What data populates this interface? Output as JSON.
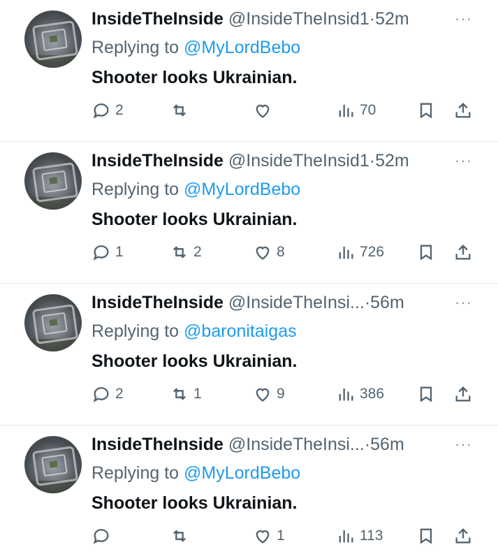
{
  "tweets": [
    {
      "name": "InsideTheInside",
      "handle": "@InsideTheInsid1",
      "dot": "·",
      "time": "52m",
      "more": "···",
      "reply_prefix": "Replying to",
      "reply_to": "@MyLordBebo",
      "text": "Shooter looks Ukrainian.",
      "replies": "2",
      "retweets": "",
      "likes": "",
      "views": "70"
    },
    {
      "name": "InsideTheInside",
      "handle": "@InsideTheInsid1",
      "dot": "·",
      "time": "52m",
      "more": "···",
      "reply_prefix": "Replying to",
      "reply_to": "@MyLordBebo",
      "text": "Shooter looks Ukrainian.",
      "replies": "1",
      "retweets": "2",
      "likes": "8",
      "views": "726"
    },
    {
      "name": "InsideTheInside",
      "handle": "@InsideTheInsi...",
      "dot": "·",
      "time": "56m",
      "more": "···",
      "reply_prefix": "Replying to",
      "reply_to": "@baronitaigas",
      "text": "Shooter looks Ukrainian.",
      "replies": "2",
      "retweets": "1",
      "likes": "9",
      "views": "386"
    },
    {
      "name": "InsideTheInside",
      "handle": "@InsideTheInsi...",
      "dot": "·",
      "time": "56m",
      "more": "···",
      "reply_prefix": "Replying to",
      "reply_to": "@MyLordBebo",
      "text": "Shooter looks Ukrainian.",
      "replies": "",
      "retweets": "",
      "likes": "1",
      "views": "113"
    }
  ],
  "icons": {
    "reply": "reply-icon",
    "retweet": "retweet-icon",
    "like": "heart-icon",
    "views": "views-icon",
    "bookmark": "bookmark-icon",
    "share": "share-icon"
  },
  "colors": {
    "mention": "#1d9bf0",
    "secondary": "#536471",
    "primary": "#0f1419"
  }
}
